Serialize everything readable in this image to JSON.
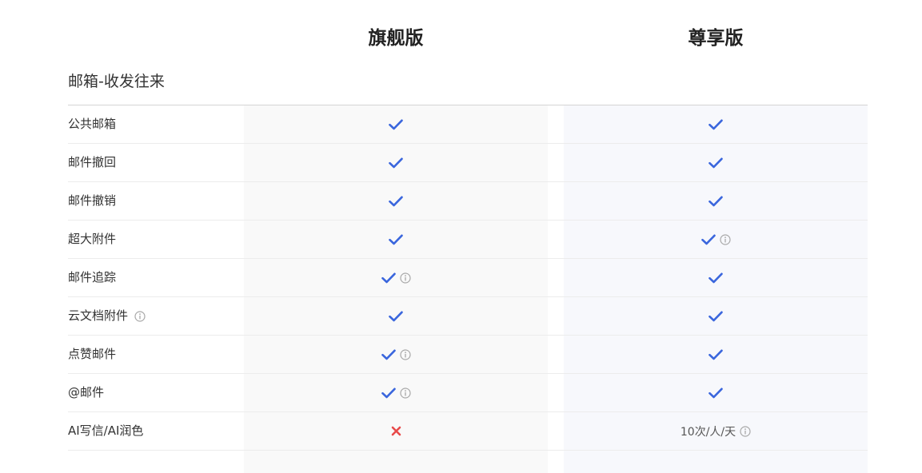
{
  "plans": {
    "flagship": "旗舰版",
    "premium": "尊享版"
  },
  "section": {
    "title": "邮箱-收发往来"
  },
  "colors": {
    "check": "#3a66dd",
    "cross": "#e84a4a",
    "info": "#a8a8a8"
  },
  "features": [
    {
      "name": "公共邮箱",
      "name_info": false,
      "flagship": {
        "status": "check",
        "info": false
      },
      "premium": {
        "status": "check",
        "info": false
      }
    },
    {
      "name": "邮件撤回",
      "name_info": false,
      "flagship": {
        "status": "check",
        "info": false
      },
      "premium": {
        "status": "check",
        "info": false
      }
    },
    {
      "name": "邮件撤销",
      "name_info": false,
      "flagship": {
        "status": "check",
        "info": false
      },
      "premium": {
        "status": "check",
        "info": false
      }
    },
    {
      "name": "超大附件",
      "name_info": false,
      "flagship": {
        "status": "check",
        "info": false
      },
      "premium": {
        "status": "check",
        "info": true
      }
    },
    {
      "name": "邮件追踪",
      "name_info": false,
      "flagship": {
        "status": "check",
        "info": true
      },
      "premium": {
        "status": "check",
        "info": false
      }
    },
    {
      "name": "云文档附件",
      "name_info": true,
      "flagship": {
        "status": "check",
        "info": false
      },
      "premium": {
        "status": "check",
        "info": false
      }
    },
    {
      "name": "点赞邮件",
      "name_info": false,
      "flagship": {
        "status": "check",
        "info": true
      },
      "premium": {
        "status": "check",
        "info": false
      }
    },
    {
      "name": "@邮件",
      "name_info": false,
      "flagship": {
        "status": "check",
        "info": true
      },
      "premium": {
        "status": "check",
        "info": false
      }
    },
    {
      "name": "AI写信/AI润色",
      "name_info": false,
      "flagship": {
        "status": "cross",
        "info": false
      },
      "premium": {
        "status": "text",
        "text": "10次/人/天",
        "info": true
      }
    }
  ]
}
